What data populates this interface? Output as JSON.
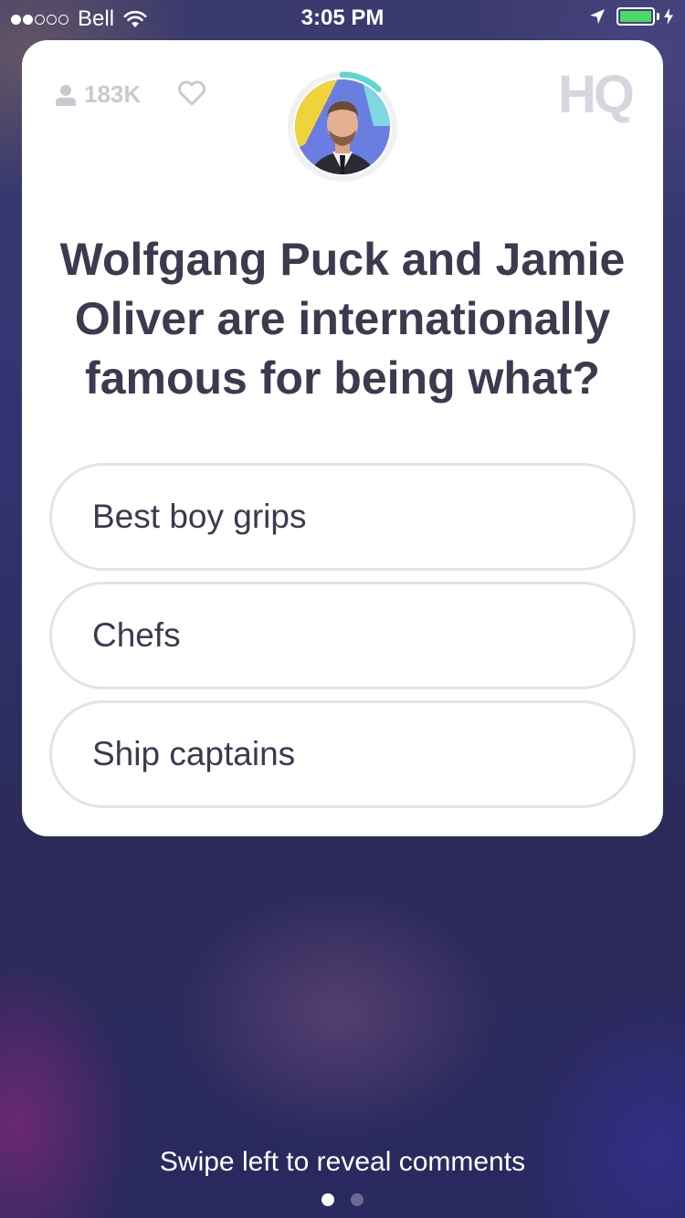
{
  "status_bar": {
    "carrier": "Bell",
    "time": "3:05 PM",
    "signal_filled": 2,
    "signal_total": 5,
    "battery_level": 1.0,
    "battery_color": "#4cd964",
    "icons": [
      "wifi-icon",
      "location-arrow-icon",
      "battery-icon",
      "charging-bolt-icon"
    ]
  },
  "header": {
    "viewer_count": "183K",
    "viewer_icon": "person-icon",
    "like_icon": "heart-outline-icon",
    "logo_text": "HQ",
    "host_avatar": "host-avatar",
    "timer_color": "#5fd6d0",
    "timer_remaining_fraction": 0.12
  },
  "question": {
    "text": "Wolfgang Puck and Jamie Oliver are internationally famous for being what?"
  },
  "answers": [
    {
      "label": "Best boy grips"
    },
    {
      "label": "Chefs"
    },
    {
      "label": "Ship captains"
    }
  ],
  "footer": {
    "hint": "Swipe left to reveal comments",
    "page_count": 2,
    "active_page": 1
  },
  "colors": {
    "card_bg": "#ffffff",
    "text_dark": "#3c3a4e",
    "muted": "#c9c9d2",
    "answer_border": "#e3e3e7"
  }
}
